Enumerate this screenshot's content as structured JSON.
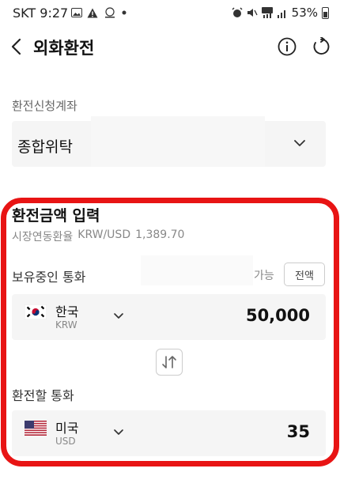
{
  "status_bar": {
    "time": "SKT 9:27",
    "battery": "53%"
  },
  "header": {
    "title": "외화환전"
  },
  "account": {
    "label": "환전신청계좌",
    "name": "종합위탁"
  },
  "exchange": {
    "section_title": "환전금액 입력",
    "rate_label": "시장연동환율",
    "rate_pair": "KRW/USD",
    "rate_value": "1,389.70",
    "have_label": "보유중인 통화",
    "available_label": "가능",
    "all_button": "전액",
    "from": {
      "name": "한국",
      "code": "KRW",
      "amount": "50,000"
    },
    "want_label": "환전할 통화",
    "to": {
      "name": "미국",
      "code": "USD",
      "amount": "35"
    }
  },
  "colors": {
    "highlight": "#e81414",
    "field_bg": "#f5f5f5",
    "muted": "#888888"
  }
}
